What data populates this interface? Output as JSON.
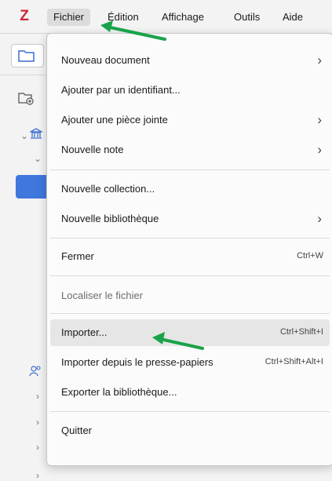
{
  "app": {
    "logo_letter": "Z",
    "logo_color": "#cc2936"
  },
  "menubar": {
    "items": [
      "Fichier",
      "Édition",
      "Affichage",
      "Outils",
      "Aide"
    ],
    "open_menu": "Fichier"
  },
  "sidebar": {
    "icons": [
      "folder-icon",
      "new-collection-icon",
      "library-icon",
      "group-icon"
    ],
    "selected_color": "#3f77dd"
  },
  "file_menu": {
    "new_item": "Nouveau document",
    "add_by_identifier": "Ajouter par un identifiant...",
    "add_attachment": "Ajouter une pièce jointe",
    "new_note": "Nouvelle note",
    "new_collection": "Nouvelle collection...",
    "new_library": "Nouvelle bibliothèque",
    "close": "Fermer",
    "close_shortcut": "Ctrl+W",
    "show_file": "Localiser le fichier",
    "import": "Importer...",
    "import_shortcut": "Ctrl+Shift+I",
    "import_clipboard": "Importer depuis le presse-papiers",
    "import_clipboard_shortcut": "Ctrl+Shift+Alt+I",
    "export_library": "Exporter la bibliothèque...",
    "quit": "Quitter"
  },
  "annotation": {
    "arrow_color": "#1aa34a"
  }
}
